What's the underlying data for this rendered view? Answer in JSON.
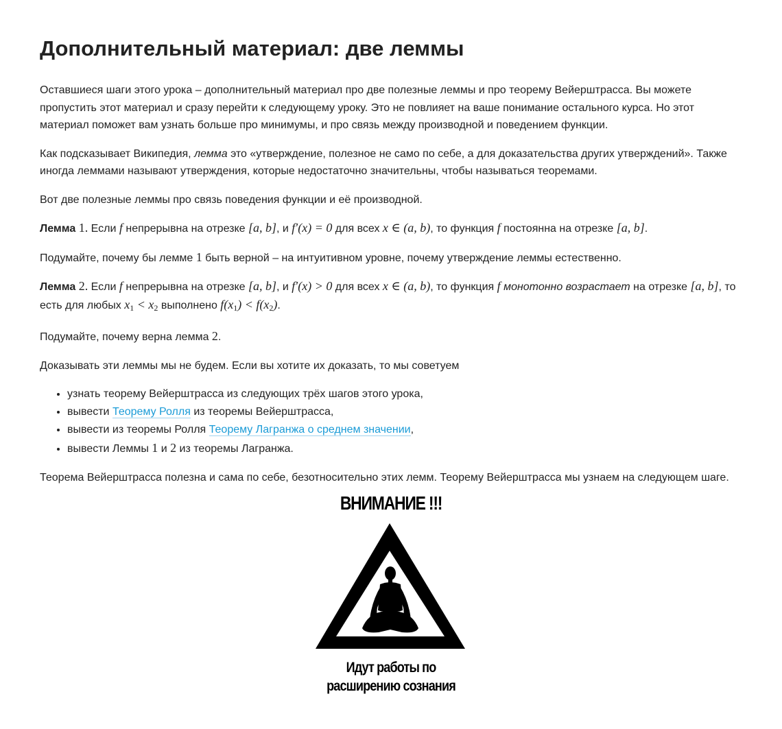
{
  "title": "Дополнительный материал: две леммы",
  "intro": "Оставшиеся шаги этого урока – дополнительный материал про две полезные леммы и про теорему Вейерштрасса. Вы можете пропустить этот материал и сразу перейти к следующему уроку. Это не повлияет на ваше понимание остального курса. Но этот материал поможет вам узнать больше про минимумы, и про связь между производной и поведением функции.",
  "wiki": {
    "before": "Как подсказывает Википедия, ",
    "term": "лемма",
    "after": " это «утверждение, полезное не само по себе, а для доказательства других утверждений». Также иногда леммами называют утверждения, которые недостаточно значительны, чтобы называться теоремами."
  },
  "lead": "Вот две полезные леммы про связь поведения функции и её производной.",
  "lemma1": {
    "label": "Лемма",
    "num": "1.",
    "t1": " Если ",
    "f": "f",
    "t2": " непрерывна на отрезке ",
    "interval": "[a, b]",
    "t3": ", и ",
    "cond": "f′(x) = 0",
    "t4": " для всех ",
    "domain": "x ∈ (a, b)",
    "t5": ", то функция ",
    "f2": "f",
    "t6": " постоянна на отрезке ",
    "interval2": "[a, b]",
    "end": "."
  },
  "think1": {
    "before": "Подумайте, почему бы лемме ",
    "num": "1",
    "after": " быть верной – на интуитивном уровне, почему утверждение леммы естественно."
  },
  "lemma2": {
    "label": "Лемма",
    "num": "2.",
    "t1": " Если ",
    "f": "f",
    "t2": " непрерывна на отрезке ",
    "interval": "[a, b]",
    "t3": ", и ",
    "cond": "f′(x) > 0",
    "t4": " для всех ",
    "domain": "x ∈ (a, b)",
    "t5": ", то функция ",
    "f2": "f",
    "t6": " ",
    "emph": "монотонно возрастает",
    "t7": " на отрезке ",
    "interval2": "[a, b]",
    "t8": ", то есть для любых ",
    "ineq1": "x",
    "t9": " выполнено ",
    "end": "."
  },
  "think2": {
    "before": "Подумайте, почему верна лемма ",
    "num": "2",
    "after": "."
  },
  "advice": "Доказывать эти леммы мы не будем. Если вы хотите их доказать, то мы советуем",
  "list": {
    "item1": "узнать теорему Вейерштрасса из следующих трёх шагов этого урока,",
    "item2_before": "вывести ",
    "item2_link": "Теорему Ролля",
    "item2_after": " из теоремы Вейерштрасса,",
    "item3_before": "вывести из теоремы Ролля ",
    "item3_link": "Теорему Лагранжа о среднем значении",
    "item3_after": ",",
    "item4_before": "вывести Леммы ",
    "item4_n1": "1",
    "item4_mid": " и ",
    "item4_n2": "2",
    "item4_after": " из теоремы Лагранжа."
  },
  "closing": "Теорема Вейерштрасса полезна и сама по себе, безотносительно этих лемм. Теорему Вейерштрасса мы узнаем на следующем шаге.",
  "poster": {
    "title": "ВНИМАНИЕ !!!",
    "caption_line1": "Идут работы по",
    "caption_line2": "расширению сознания"
  },
  "colors": {
    "link": "#1a9bd7",
    "text": "#222222"
  }
}
